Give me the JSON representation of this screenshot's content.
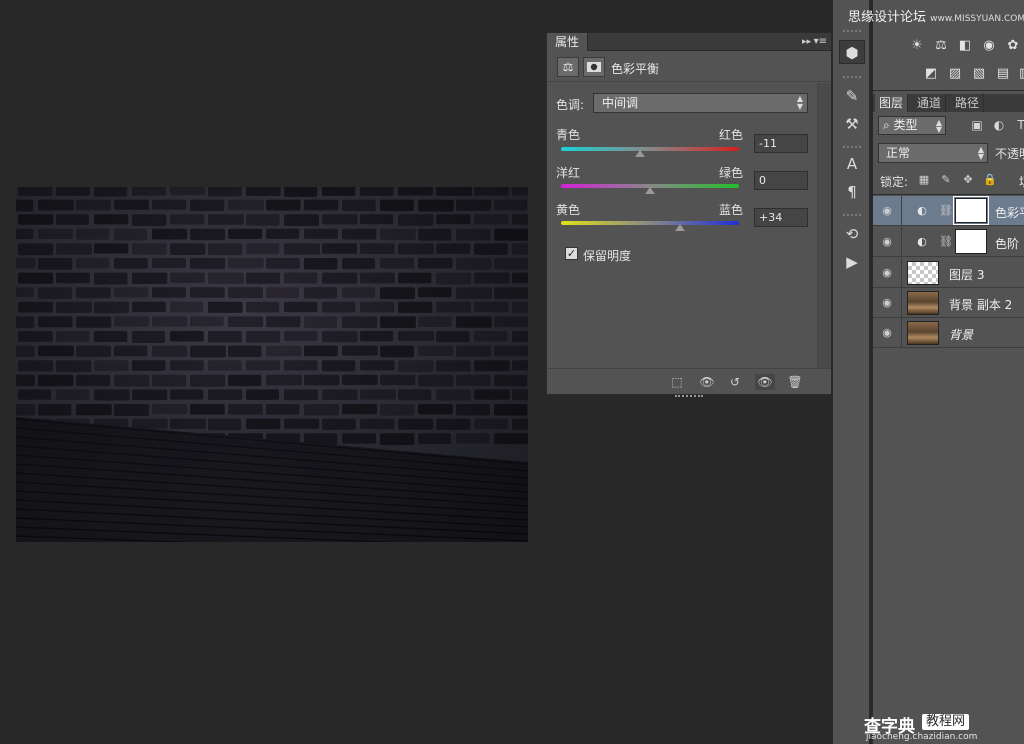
{
  "properties_panel": {
    "tab_label": "属性",
    "collapse_glyph": "▸▸",
    "menu_glyph": "▾≡",
    "title": "色彩平衡",
    "tone_label": "色调:",
    "tone_value": "中间调",
    "sliders": [
      {
        "left": "青色",
        "right": "红色",
        "value": "-11",
        "amount": -11,
        "colors": [
          "#19d3d8",
          "#d81e1e"
        ]
      },
      {
        "left": "洋红",
        "right": "绿色",
        "value": "0",
        "amount": 0,
        "colors": [
          "#d61fd6",
          "#20c02a"
        ]
      },
      {
        "left": "黄色",
        "right": "蓝色",
        "value": "+34",
        "amount": 34,
        "colors": [
          "#e3df19",
          "#1f2fd6"
        ]
      }
    ],
    "preserve_luminosity_label": "保留明度",
    "preserve_luminosity_checked": true
  },
  "layers_panel": {
    "tabs": [
      "图层",
      "通道",
      "路径"
    ],
    "filter_label": "类型",
    "blend_mode": "正常",
    "opacity_label": "不透明",
    "lock_label": "锁定:",
    "fill_label": "填",
    "layers": [
      {
        "name": "色彩平衡",
        "type": "adjustment",
        "selected": true
      },
      {
        "name": "色阶",
        "type": "adjustment",
        "selected": false
      },
      {
        "name": "图层 3",
        "type": "transparent",
        "selected": false
      },
      {
        "name": "背景 副本 2",
        "type": "image",
        "selected": false
      },
      {
        "name": "背景",
        "type": "image",
        "selected": false
      }
    ]
  },
  "watermark_top": {
    "site_name": "思缘设计论坛",
    "url": "www.MISSYUAN.COM"
  },
  "watermark_bottom": {
    "brand": "查字典",
    "tag": "教程网",
    "url": "jiaocheng.chazidian.com"
  },
  "colors": {
    "canvas_bg": "#282828",
    "panel_bg": "#535353",
    "selected_layer": "#6d7b8e"
  }
}
